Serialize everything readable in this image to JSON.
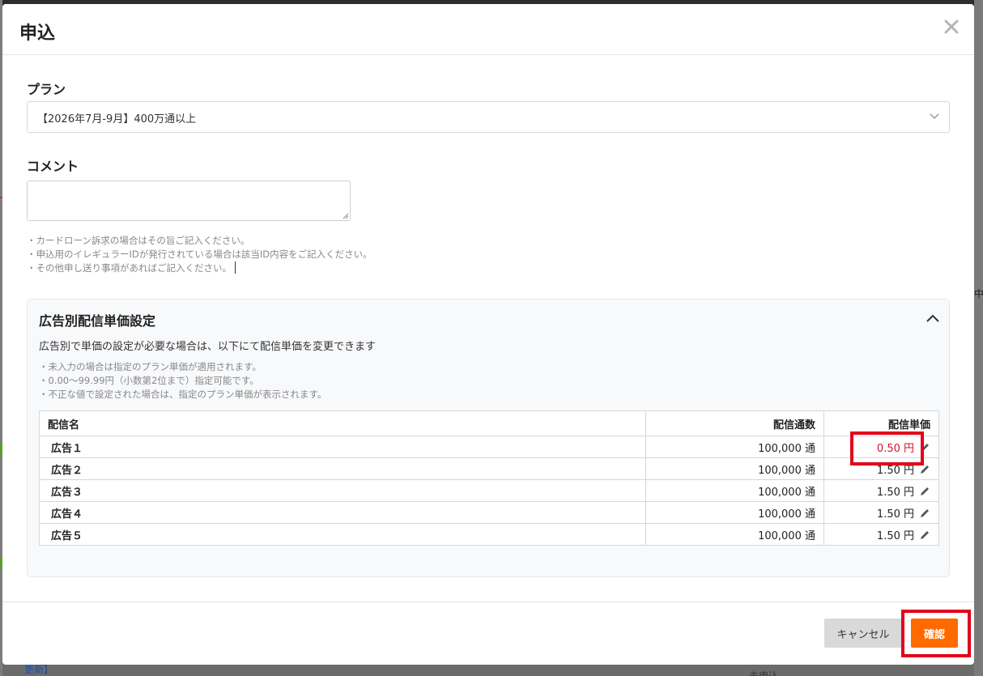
{
  "modal": {
    "title": "申込",
    "plan_label": "プラン",
    "plan_value": "【2026年7月-9月】400万通以上",
    "comment_label": "コメント",
    "comment_value": "",
    "comment_hints": [
      "・カードローン訴求の場合はその旨ご記入ください。",
      "・申込用のイレギュラーIDが発行されている場合は該当ID内容をご記入ください。",
      "・その他申し送り事項があればご記入ください。"
    ]
  },
  "rate_panel": {
    "title": "広告別配信単価設定",
    "description": "広告別で単価の設定が必要な場合は、以下にて配信単価を変更できます",
    "notes": [
      "・未入力の場合は指定のプラン単価が適用されます。",
      "・0.00～99.99円（小数第2位まで）指定可能です。",
      "・不正な値で設定された場合は、指定のプラン単価が表示されます。"
    ],
    "headers": {
      "name": "配信名",
      "count": "配信通数",
      "price": "配信単価"
    },
    "rows": [
      {
        "name": "広告１",
        "count": "100,000 通",
        "price": "0.50 円"
      },
      {
        "name": "広告２",
        "count": "100,000 通",
        "price": "1.50 円"
      },
      {
        "name": "広告３",
        "count": "100,000 通",
        "price": "1.50 円"
      },
      {
        "name": "広告４",
        "count": "100,000 通",
        "price": "1.50 円"
      },
      {
        "name": "広告５",
        "count": "100,000 通",
        "price": "1.50 円"
      }
    ]
  },
  "footer": {
    "cancel_label": "キャンセル",
    "confirm_label": "確認"
  },
  "background": {
    "bottom_link": "更新】",
    "bottom_right": "未申込",
    "right_text": "中"
  },
  "colors": {
    "confirm": "#ff6a00",
    "highlight": "#e3001b",
    "changed_price": "#d0152b"
  }
}
